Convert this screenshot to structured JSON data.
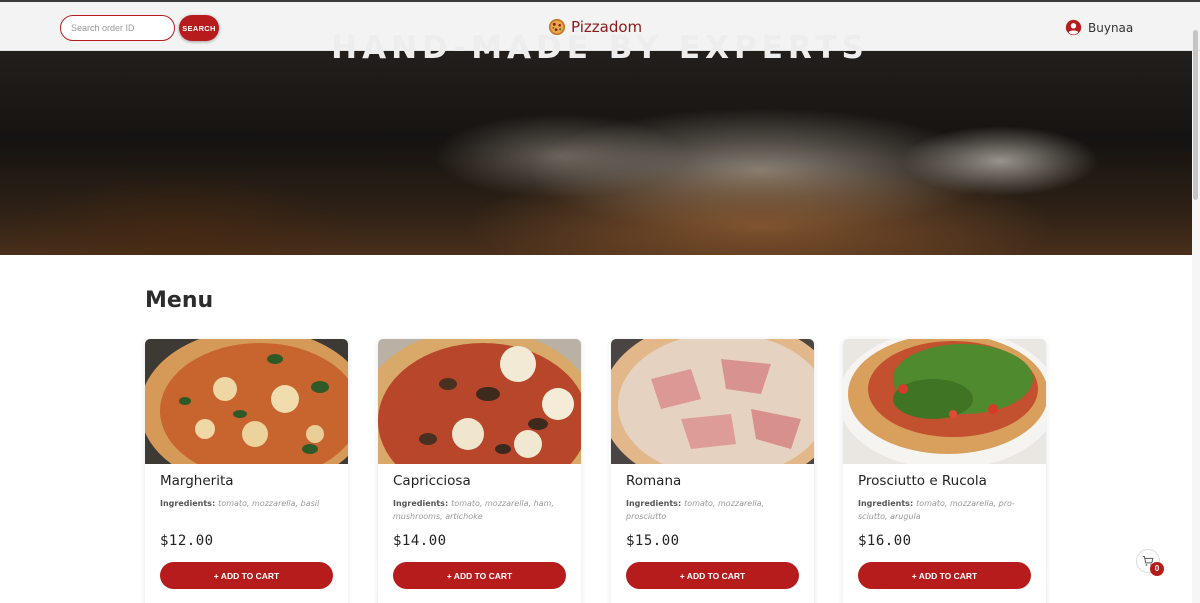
{
  "header": {
    "search": {
      "placeholder": "Search order ID",
      "button_label": "SEARCH"
    },
    "logo": {
      "text": "Pizzadom",
      "icon": "pizza-icon"
    },
    "user": {
      "name": "Buynaa",
      "icon": "user-circle-icon"
    }
  },
  "hero": {
    "title": "HAND-MADE BY EXPERTS"
  },
  "menu": {
    "title": "Menu",
    "ingredients_label": "Ingredients:",
    "add_label": "+ ADD TO CART",
    "items": [
      {
        "name": "Margherita",
        "ingredients": "tomato, mozzarella, basil",
        "price": "$12.00"
      },
      {
        "name": "Capricciosa",
        "ingredients": "tomato, mozzarella, ham, mushrooms, artichoke",
        "price": "$14.00"
      },
      {
        "name": "Romana",
        "ingredients": "tomato, mozzarella, prosciutto",
        "price": "$15.00"
      },
      {
        "name": "Prosciutto e Rucola",
        "ingredients": "tomato, mozzarella, pro-sciutto, arugula",
        "price": "$16.00"
      }
    ]
  },
  "cart": {
    "icon": "cart-icon",
    "count": "0"
  },
  "colors": {
    "accent": "#b71c1c",
    "logo_text": "#8b1a1a",
    "header_bg": "#f3f3f3"
  }
}
